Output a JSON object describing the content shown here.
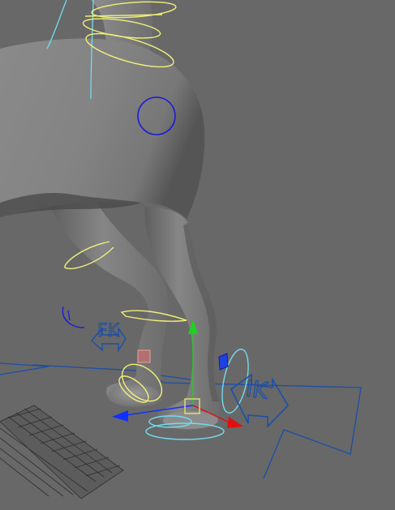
{
  "viewport": {
    "background_color": "#686868",
    "model_color": "#7d7d7d",
    "fk_label": "FK",
    "ik_label": "IK",
    "colors": {
      "control_yellow": "#f0f07a",
      "control_cyan": "#70dcf0",
      "control_blue": "#1b1bd6",
      "ground_line": "#1a4fa8",
      "grid_line": "#2a2a2a",
      "manip_y": "#20d020",
      "manip_x": "#e01010",
      "manip_z": "#1030ff",
      "manip_center": "#e8e070",
      "pole_vector": "#c07070"
    },
    "icons": [
      "fk-ik-switch-icon",
      "move-manipulator-icon"
    ]
  }
}
